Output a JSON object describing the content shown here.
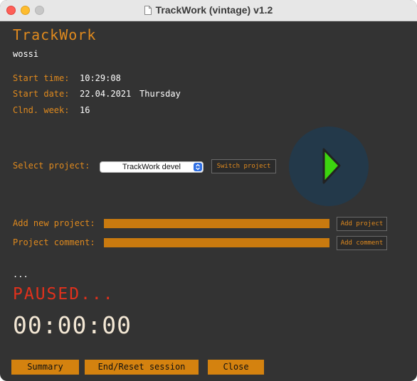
{
  "window": {
    "title": "TrackWork (vintage) v1.2"
  },
  "app": {
    "title": "TrackWork",
    "username": "wossi"
  },
  "session": {
    "start_time_label": "Start time:",
    "start_time": "10:29:08",
    "start_date_label": "Start date:",
    "start_date": "22.04.2021",
    "weekday": "Thursday",
    "week_label": "Clnd. week:",
    "week": "16"
  },
  "project": {
    "select_label": "Select project:",
    "selected": "TrackWork devel",
    "switch_button": "Switch project"
  },
  "new_project": {
    "label": "Add new project:",
    "value": "",
    "button": "Add project"
  },
  "comment": {
    "label": "Project comment:",
    "value": "",
    "button": "Add comment"
  },
  "status": {
    "message": "...",
    "state": "PAUSED...",
    "elapsed": "00:00:00"
  },
  "footer": {
    "summary": "Summary",
    "end_reset": "End/Reset session",
    "close": "Close"
  },
  "colors": {
    "background": "#333333",
    "accent": "#e08a1e",
    "paused": "#e1311c",
    "play": "#3cd40f"
  },
  "icons": {
    "play": "play-icon",
    "document": "document-icon"
  }
}
